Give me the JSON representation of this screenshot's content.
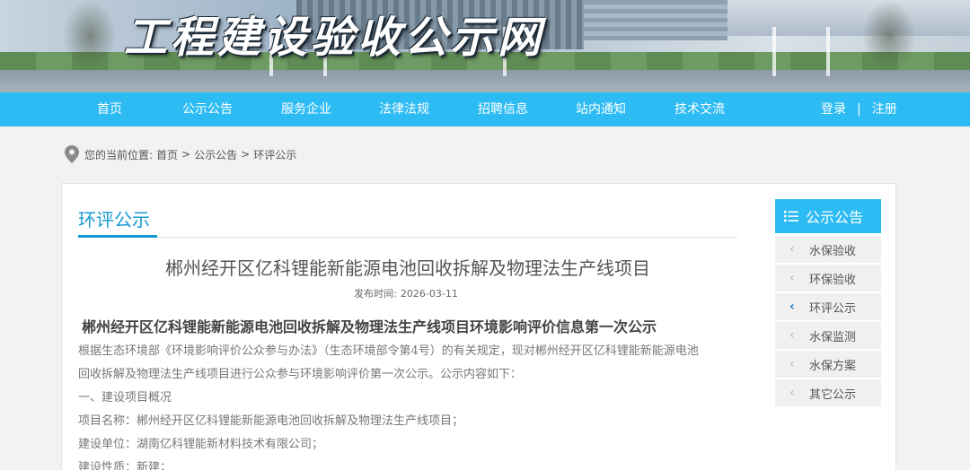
{
  "site": {
    "title": "工程建设验收公示网"
  },
  "nav": {
    "items": [
      "首页",
      "公示公告",
      "服务企业",
      "法律法规",
      "招聘信息",
      "站内通知",
      "技术交流"
    ],
    "login": "登录",
    "separator": "|",
    "register": "注册"
  },
  "breadcrumb": {
    "prefix": "您的当前位置:",
    "items": [
      "首页",
      "公示公告",
      "环评公示"
    ],
    "sep": ">"
  },
  "section": {
    "title": "环评公示"
  },
  "article": {
    "title": "郴州经开区亿科锂能新能源电池回收拆解及物理法生产线项目",
    "date_label": "发布时间:",
    "date": "2026-03-11",
    "subtitle": "郴州经开区亿科锂能新能源电池回收拆解及物理法生产线项目环境影响评价信息第一次公示",
    "paragraphs": [
      "根据生态环境部《环境影响评价公众参与办法》（生态环境部令第4号）的有关规定，现对郴州经开区亿科锂能新能源电池",
      "回收拆解及物理法生产线项目进行公众参与环境影响评价第一次公示。公示内容如下：",
      "一、建设项目概况",
      "项目名称：郴州经开区亿科锂能新能源电池回收拆解及物理法生产线项目；",
      "建设单位：湖南亿科锂能新材料技术有限公司；",
      "建设性质：新建；"
    ]
  },
  "sidebar": {
    "header": "公示公告",
    "items": [
      {
        "label": "水保验收",
        "active": false
      },
      {
        "label": "环保验收",
        "active": false
      },
      {
        "label": "环评公示",
        "active": true
      },
      {
        "label": "水保监测",
        "active": false
      },
      {
        "label": "水保方案",
        "active": false
      },
      {
        "label": "其它公示",
        "active": false
      }
    ]
  },
  "colors": {
    "accent": "#2cbbf3",
    "title_blue": "#1598d6",
    "active_chev": "#1a7cc4"
  },
  "icons": {
    "breadcrumb": "location-pin-icon",
    "sidebar_header": "list-menu-icon",
    "sidebar_item": "chevron-left-icon"
  }
}
